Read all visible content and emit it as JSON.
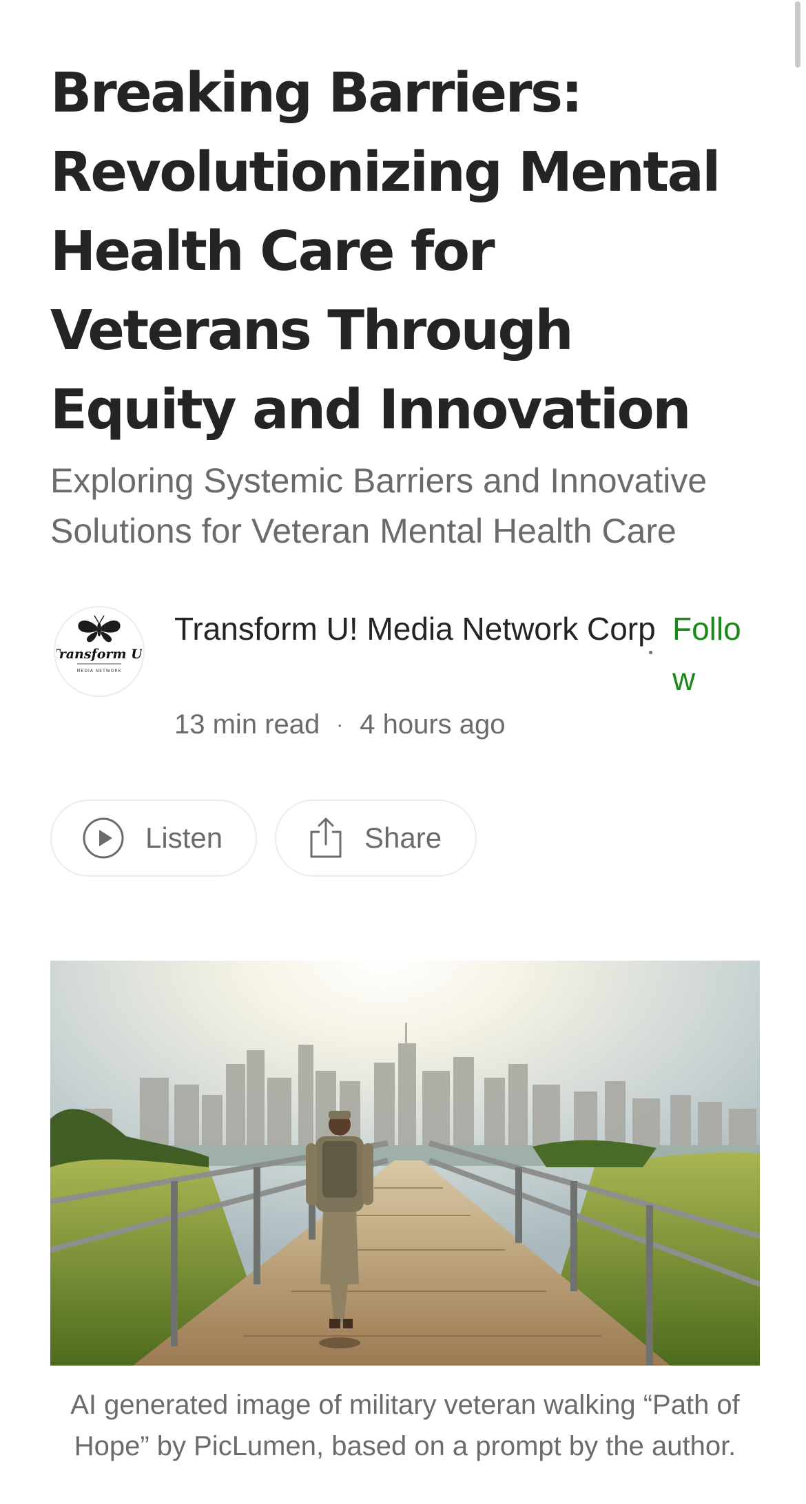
{
  "article": {
    "title": "Breaking Barriers: Revolutionizing Mental Health Care for Veterans Through Equity and Innovation",
    "subtitle": "Exploring Systemic Barriers and Innovative Solutions for Veteran Mental Health Care"
  },
  "author": {
    "name": "Transform U! Media Network Corp",
    "follow_label": "Follow",
    "avatar_logo_text": "Transform U!",
    "avatar_logo_subtext": "MEDIA NETWORK",
    "read_time": "13 min read",
    "separator": "·",
    "published": "4 hours ago"
  },
  "actions": {
    "listen_label": "Listen",
    "share_label": "Share",
    "listen_icon": "play-circle-icon",
    "share_icon": "share-upload-icon"
  },
  "image": {
    "caption": "AI generated image of military veteran walking “Path of Hope” by PicLumen, based on a prompt by the author."
  },
  "colors": {
    "text_primary": "#242424",
    "text_secondary": "#6b6b6b",
    "follow_green": "#1a8917",
    "pill_border": "#ececec"
  }
}
